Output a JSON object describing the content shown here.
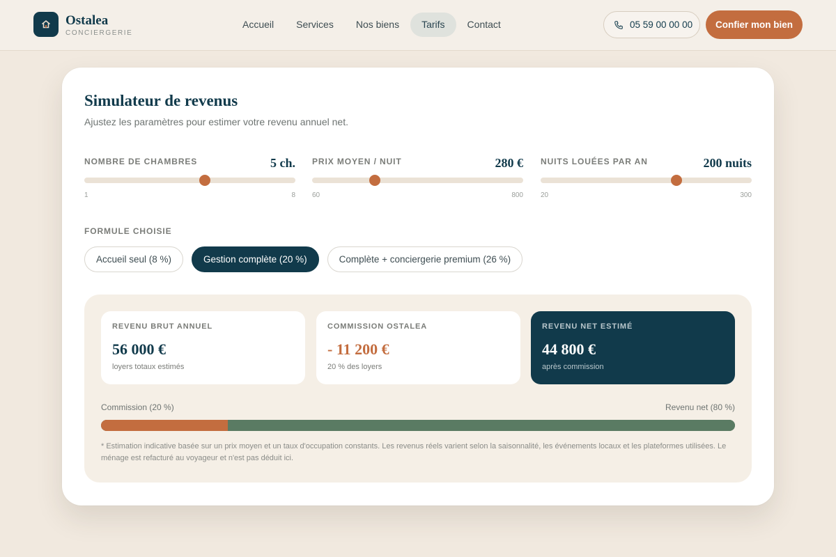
{
  "header": {
    "brand_name": "Ostalea",
    "brand_sub": "CONCIERGERIE",
    "nav": [
      {
        "label": "Accueil",
        "active": false
      },
      {
        "label": "Services",
        "active": false
      },
      {
        "label": "Nos biens",
        "active": false
      },
      {
        "label": "Tarifs",
        "active": true
      },
      {
        "label": "Contact",
        "active": false
      }
    ],
    "phone": "05 59 00 00 00",
    "cta": "Confier mon bien"
  },
  "simulator": {
    "title": "Simulateur de revenus",
    "subtitle": "Ajustez les paramètres pour estimer votre revenu annuel net.",
    "sliders": [
      {
        "label": "NOMBRE DE CHAMBRES",
        "display": "5 ch.",
        "value": 5,
        "min": 1,
        "max": 8,
        "min_label": "1",
        "max_label": "8"
      },
      {
        "label": "PRIX MOYEN / NUIT",
        "display": "280 €",
        "value": 280,
        "min": 60,
        "max": 800,
        "min_label": "60",
        "max_label": "800"
      },
      {
        "label": "NUITS LOUÉES PAR AN",
        "display": "200 nuits",
        "value": 200,
        "min": 20,
        "max": 300,
        "min_label": "20",
        "max_label": "300"
      }
    ],
    "formule_label": "FORMULE CHOISIE",
    "formules": [
      {
        "label": "Accueil seul (8 %)",
        "active": false
      },
      {
        "label": "Gestion complète (20 %)",
        "active": true
      },
      {
        "label": "Complète + conciergerie premium (26 %)",
        "active": false
      }
    ]
  },
  "results": {
    "gross": {
      "label": "REVENU BRUT ANNUEL",
      "value": "56 000 €",
      "note": "loyers totaux estimés"
    },
    "commission": {
      "label": "COMMISSION OSTALEA",
      "value": "- 11 200 €",
      "note": "20 % des loyers"
    },
    "net": {
      "label": "REVENU NET ESTIMÉ",
      "value": "44 800 €",
      "note": "après commission"
    },
    "split_left_label": "Commission (20 %)",
    "split_right_label": "Revenu net (80 %)",
    "commission_share": 0.2,
    "disclaimer": "* Estimation indicative basée sur un prix moyen et un taux d'occupation constants. Les revenus réels varient selon la saisonnalité, les événements locaux et les plateformes utilisées. Le ménage est refacturé au voyageur et n'est pas déduit ici."
  },
  "colors": {
    "primary": "#113a4b",
    "accent": "#c36d3f",
    "net_green": "#5a7b63",
    "background": "#f1e9df"
  }
}
